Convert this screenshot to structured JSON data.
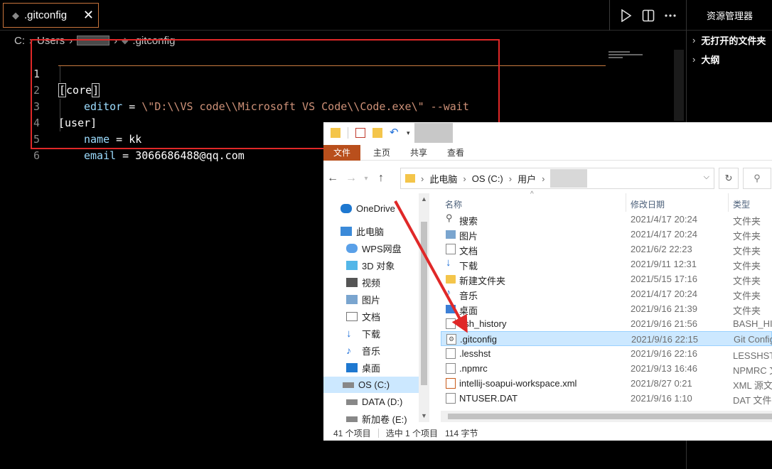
{
  "tab": {
    "label": ".gitconfig",
    "close": "✕"
  },
  "breadcrumb": {
    "drive": "C:",
    "folder": "Users",
    "file": ".gitconfig"
  },
  "editor": {
    "lines": [
      {
        "num": "1",
        "bracket": "core"
      },
      {
        "num": "2",
        "key": "editor",
        "eq": " = ",
        "value": "\\\"D:\\\\VS code\\\\Microsoft VS Code\\\\Code.exe\\\" --wait"
      },
      {
        "num": "3",
        "section": "[user]"
      },
      {
        "num": "4",
        "key": "name",
        "eq": " = ",
        "value": "kk"
      },
      {
        "num": "5",
        "key": "email",
        "eq": " = ",
        "value": "3066686488@qq.com"
      },
      {
        "num": "6"
      }
    ],
    "accent_color": "#c87b40",
    "highlight_color": "#e02828"
  },
  "sidebar": {
    "title": "资源管理器",
    "sections": [
      "无打开的文件夹",
      "大纲"
    ]
  },
  "explorer": {
    "ribbon_tabs": [
      "文件",
      "主页",
      "共享",
      "查看"
    ],
    "address": [
      "此电脑",
      "OS (C:)",
      "用户"
    ],
    "search_placeholder": "",
    "nav_items": [
      "OneDrive",
      "此电脑",
      "WPS网盘",
      "3D 对象",
      "视频",
      "图片",
      "文档",
      "下载",
      "音乐",
      "桌面",
      "OS (C:)",
      "DATA (D:)",
      "新加卷 (E:)"
    ],
    "columns": [
      "名称",
      "修改日期",
      "类型"
    ],
    "files": [
      {
        "name": "搜索",
        "date": "2021/4/17 20:24",
        "type": "文件夹",
        "icon": "search-icon"
      },
      {
        "name": "图片",
        "date": "2021/4/17 20:24",
        "type": "文件夹",
        "icon": "pictures-icon"
      },
      {
        "name": "文档",
        "date": "2021/6/2 22:23",
        "type": "文件夹",
        "icon": "documents-icon"
      },
      {
        "name": "下载",
        "date": "2021/9/11 12:31",
        "type": "文件夹",
        "icon": "download-icon"
      },
      {
        "name": "新建文件夹",
        "date": "2021/5/15 17:16",
        "type": "文件夹",
        "icon": "folder-icon"
      },
      {
        "name": "音乐",
        "date": "2021/4/17 20:24",
        "type": "文件夹",
        "icon": "music-icon"
      },
      {
        "name": "桌面",
        "date": "2021/9/16 21:39",
        "type": "文件夹",
        "icon": "desktop-icon"
      },
      {
        "name": "ash_history",
        "date": "2021/9/16 21:56",
        "type": "BASH_HIS",
        "icon": "file-icon"
      },
      {
        "name": ".gitconfig",
        "date": "2021/9/16 22:15",
        "type": "Git Config",
        "icon": "gear-file-icon"
      },
      {
        "name": ".lesshst",
        "date": "2021/9/16 22:16",
        "type": "LESSHST 文",
        "icon": "file-icon"
      },
      {
        "name": ".npmrc",
        "date": "2021/9/13 16:46",
        "type": "NPMRC 文",
        "icon": "file-icon"
      },
      {
        "name": "intellij-soapui-workspace.xml",
        "date": "2021/8/27 0:21",
        "type": "XML 源文",
        "icon": "xml-file-icon"
      },
      {
        "name": "NTUSER.DAT",
        "date": "2021/9/16 1:10",
        "type": "DAT 文件",
        "icon": "file-icon"
      }
    ],
    "status": {
      "count": "41 个项目",
      "selected": "选中 1 个项目",
      "size": "114 字节"
    }
  }
}
